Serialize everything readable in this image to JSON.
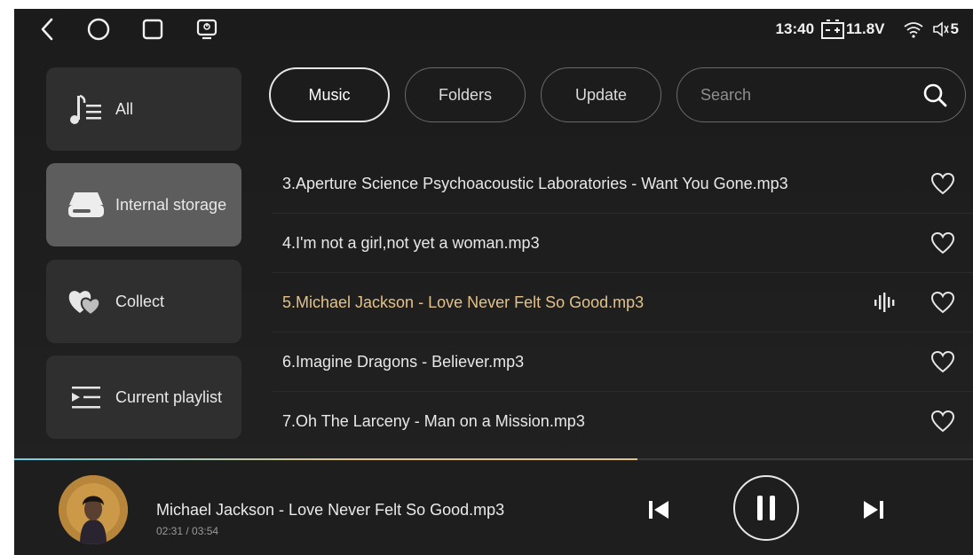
{
  "status": {
    "time": "13:40",
    "voltage": "11.8V",
    "volume": "5"
  },
  "nav": {
    "icons": [
      "back-icon",
      "home-icon",
      "recents-icon",
      "screen-icon"
    ]
  },
  "sidebar": {
    "items": [
      {
        "label": "All",
        "icon": "music-list-icon",
        "active": false
      },
      {
        "label": "Internal storage",
        "icon": "storage-icon",
        "active": true
      },
      {
        "label": "Collect",
        "icon": "hearts-icon",
        "active": false
      },
      {
        "label": "Current playlist",
        "icon": "playlist-icon",
        "active": false
      }
    ]
  },
  "tabs": [
    {
      "label": "Music",
      "active": true
    },
    {
      "label": "Folders",
      "active": false
    },
    {
      "label": "Update",
      "active": false
    }
  ],
  "search": {
    "placeholder": "Search",
    "value": ""
  },
  "songs": [
    {
      "title": "3.Aperture Science Psychoacoustic Laboratories - Want You Gone.mp3",
      "playing": false
    },
    {
      "title": "4.I'm not a girl,not yet a woman.mp3",
      "playing": false
    },
    {
      "title": "5.Michael Jackson - Love Never Felt So Good.mp3",
      "playing": true
    },
    {
      "title": "6.Imagine Dragons - Believer.mp3",
      "playing": false
    },
    {
      "title": "7.Oh The Larceny - Man on a Mission.mp3",
      "playing": false
    }
  ],
  "player": {
    "title": "Michael Jackson - Love Never Felt So Good.mp3",
    "time": "02:31 / 03:54",
    "progress": 0.65
  },
  "colors": {
    "accent": "#e3c289",
    "background": "#1f1f1f",
    "active_sidebar": "#5d5d5d"
  }
}
